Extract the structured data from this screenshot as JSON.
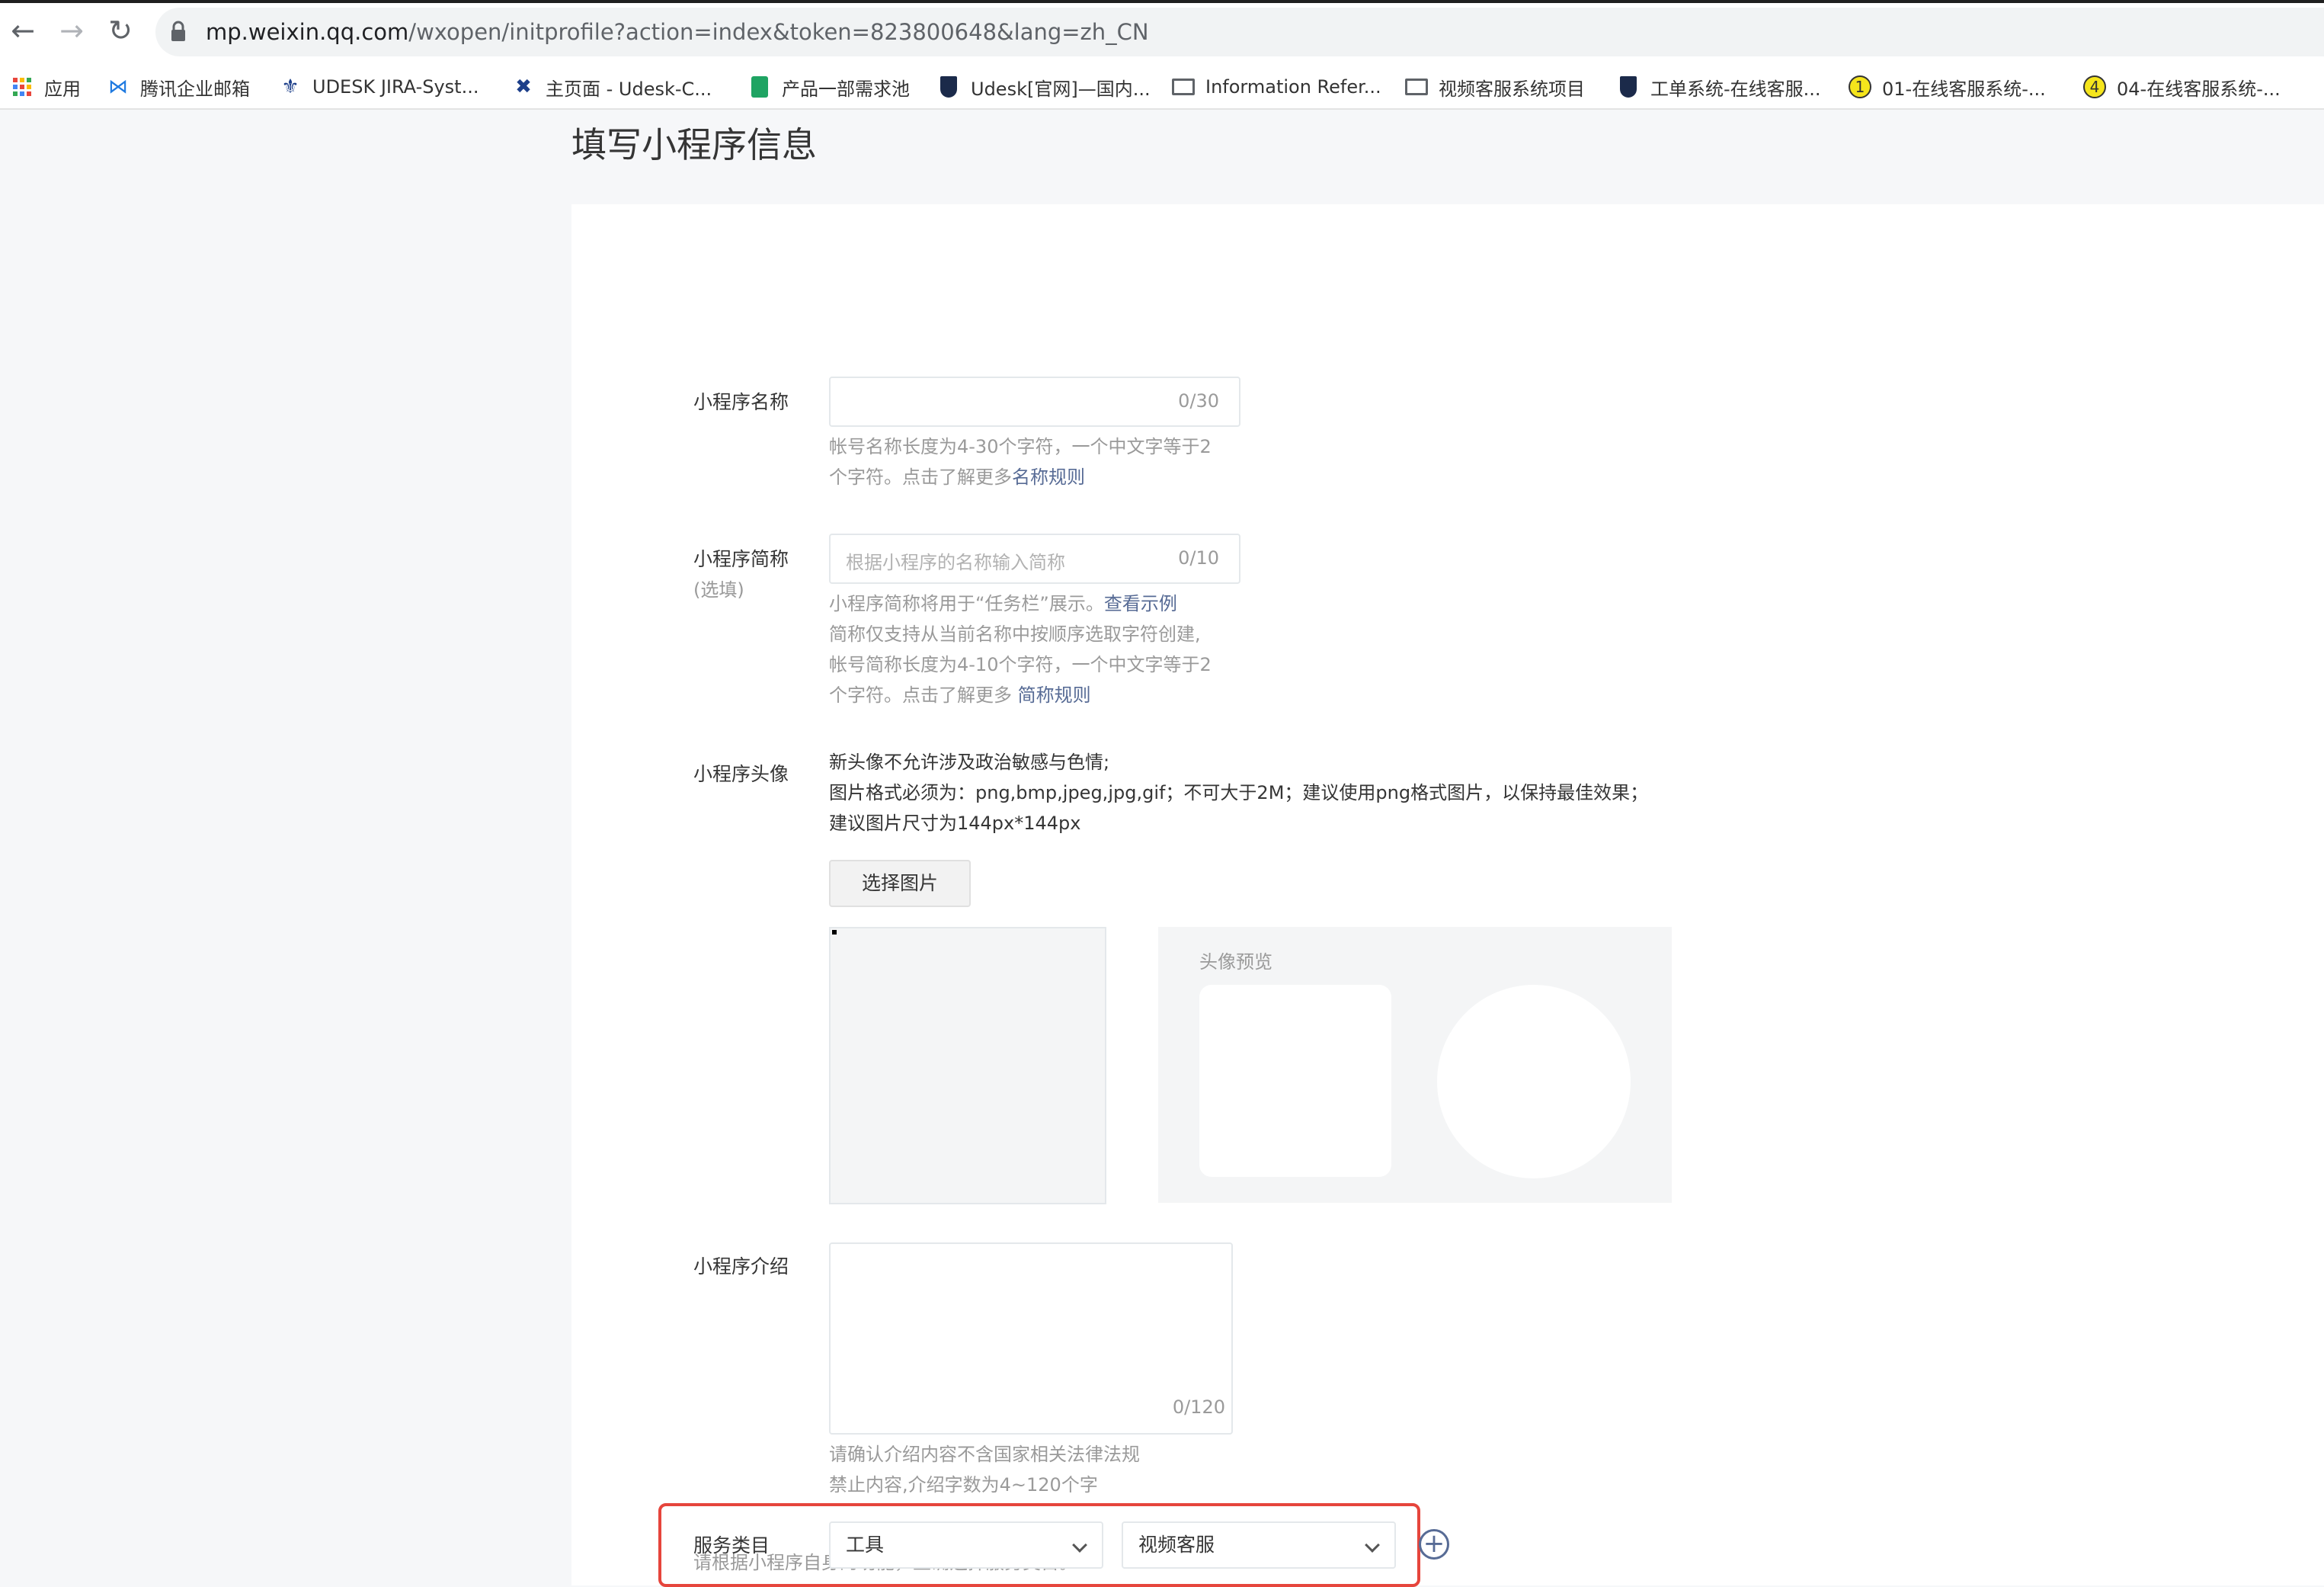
{
  "browser": {
    "url_host": "mp.weixin.qq.com",
    "url_path": "/wxopen/initprofile?action=index&token=823800648&lang=zh_CN",
    "bookmarks": [
      {
        "label": "应用",
        "icon": "apps-grid-icon"
      },
      {
        "label": "腾讯企业邮箱",
        "icon": "tencent-mail-icon"
      },
      {
        "label": "UDESK JIRA-Syst...",
        "icon": "jira-icon"
      },
      {
        "label": "主页面 - Udesk-C...",
        "icon": "confluence-icon"
      },
      {
        "label": "产品一部需求池",
        "icon": "sheet-icon"
      },
      {
        "label": "Udesk[官网]—国内...",
        "icon": "udesk-shield-icon"
      },
      {
        "label": "Information Refer...",
        "icon": "folder-icon"
      },
      {
        "label": "视频客服系统项目",
        "icon": "folder-icon"
      },
      {
        "label": "工单系统-在线客服...",
        "icon": "udesk-shield-icon"
      },
      {
        "label": "01-在线客服系统-...",
        "icon": "number-1-icon"
      },
      {
        "label": "04-在线客服系统-...",
        "icon": "number-4-icon"
      }
    ]
  },
  "page": {
    "title": "填写小程序信息",
    "name_field": {
      "label": "小程序名称",
      "value": "",
      "counter": "0/30",
      "hint_line1": "帐号名称长度为4-30个字符，一个中文字等于2",
      "hint_line2": "个字符。点击了解更多",
      "hint_link": "名称规则"
    },
    "short_name_field": {
      "label": "小程序简称",
      "optional": "(选填)",
      "placeholder": "根据小程序的名称输入简称",
      "counter": "0/10",
      "hint_line1": "小程序简称将用于“任务栏”展示。",
      "hint_line1_link": "查看示例",
      "hint_line2": "简称仅支持从当前名称中按顺序选取字符创建,",
      "hint_line3": "帐号简称长度为4-10个字符，一个中文字等于2",
      "hint_line4": "个字符。点击了解更多 ",
      "hint_line4_link": "简称规则"
    },
    "avatar": {
      "label": "小程序头像",
      "rule1": "新头像不允许涉及政治敏感与色情;",
      "rule2": "图片格式必须为：png,bmp,jpeg,jpg,gif；不可大于2M；建议使用png格式图片，以保持最佳效果；",
      "rule3": "建议图片尺寸为144px*144px",
      "choose_button": "选择图片",
      "preview_title": "头像预览"
    },
    "intro": {
      "label": "小程序介绍",
      "value": "",
      "counter": "0/120",
      "hint_line1": "请确认介绍内容不含国家相关法律法规",
      "hint_line2": "禁止内容,介绍字数为4~120个字"
    },
    "category": {
      "note": "请根据小程序自身的功能，正确选择服务类目。",
      "label": "服务类目",
      "primary": "工具",
      "secondary": "视频客服"
    }
  },
  "colors": {
    "link": "#576b95",
    "highlight": "#e6453c"
  }
}
